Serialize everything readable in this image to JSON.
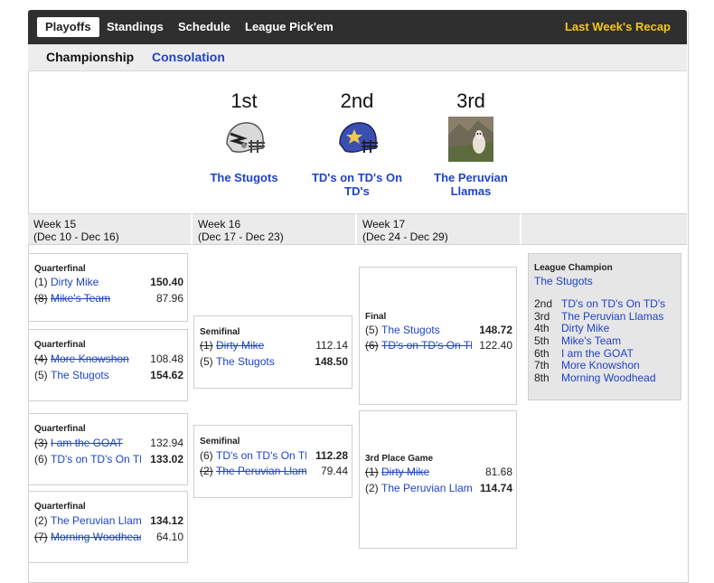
{
  "topnav": {
    "tabs": [
      {
        "label": "Playoffs",
        "active": true
      },
      {
        "label": "Standings",
        "active": false
      },
      {
        "label": "Schedule",
        "active": false
      },
      {
        "label": "League Pick'em",
        "active": false
      }
    ],
    "recap": "Last Week's Recap"
  },
  "subnav": {
    "championship": "Championship",
    "consolation": "Consolation"
  },
  "winners": [
    {
      "rank": "1st",
      "team": "The Stugots",
      "logo": "silver-helmet-icon"
    },
    {
      "rank": "2nd",
      "team": "TD's on TD's On TD's",
      "logo": "blue-helmet-icon"
    },
    {
      "rank": "3rd",
      "team": "The Peruvian Llamas",
      "logo": "llama-photo-icon"
    }
  ],
  "weeks": [
    {
      "label": "Week 15",
      "dates": "(Dec 10 - Dec 16)"
    },
    {
      "label": "Week 16",
      "dates": "(Dec 17 - Dec 23)"
    },
    {
      "label": "Week 17",
      "dates": "(Dec 24 - Dec 29)"
    }
  ],
  "matchups": {
    "qf1": {
      "round": "Quarterfinal",
      "teams": [
        {
          "seed": "(1)",
          "name": "Dirty Mike",
          "score": "150.40",
          "won": true
        },
        {
          "seed": "(8)",
          "name": "Mike's Team",
          "score": "87.96",
          "won": false
        }
      ]
    },
    "qf2": {
      "round": "Quarterfinal",
      "teams": [
        {
          "seed": "(4)",
          "name": "More Knowshon",
          "score": "108.48",
          "won": false
        },
        {
          "seed": "(5)",
          "name": "The Stugots",
          "score": "154.62",
          "won": true
        }
      ]
    },
    "qf3": {
      "round": "Quarterfinal",
      "teams": [
        {
          "seed": "(3)",
          "name": "I am the GOAT",
          "score": "132.94",
          "won": false
        },
        {
          "seed": "(6)",
          "name": "TD's on TD's On TD's",
          "score": "133.02",
          "won": true
        }
      ]
    },
    "qf4": {
      "round": "Quarterfinal",
      "teams": [
        {
          "seed": "(2)",
          "name": "The Peruvian Llamas",
          "score": "134.12",
          "won": true
        },
        {
          "seed": "(7)",
          "name": "Morning Woodhead",
          "score": "64.10",
          "won": false
        }
      ]
    },
    "sf1": {
      "round": "Semifinal",
      "teams": [
        {
          "seed": "(1)",
          "name": "Dirty Mike",
          "score": "112.14",
          "won": false
        },
        {
          "seed": "(5)",
          "name": "The Stugots",
          "score": "148.50",
          "won": true
        }
      ]
    },
    "sf2": {
      "round": "Semifinal",
      "teams": [
        {
          "seed": "(6)",
          "name": "TD's on TD's On TD's",
          "score": "112.28",
          "won": true
        },
        {
          "seed": "(2)",
          "name": "The Peruvian Llamas",
          "score": "79.44",
          "won": false
        }
      ]
    },
    "final": {
      "round": "Final",
      "teams": [
        {
          "seed": "(5)",
          "name": "The Stugots",
          "score": "148.72",
          "won": true
        },
        {
          "seed": "(6)",
          "name": "TD's on TD's On TD's",
          "score": "122.40",
          "won": false
        }
      ]
    },
    "third": {
      "round": "3rd Place Game",
      "teams": [
        {
          "seed": "(1)",
          "name": "Dirty Mike",
          "score": "81.68",
          "won": false
        },
        {
          "seed": "(2)",
          "name": "The Peruvian Llamas",
          "score": "114.74",
          "won": true
        }
      ]
    }
  },
  "champion": {
    "title": "League Champion",
    "name": "The Stugots",
    "finish": [
      {
        "place": "2nd",
        "team": "TD's on TD's On TD's"
      },
      {
        "place": "3rd",
        "team": "The Peruvian Llamas"
      },
      {
        "place": "4th",
        "team": "Dirty Mike"
      },
      {
        "place": "5th",
        "team": "Mike's Team"
      },
      {
        "place": "6th",
        "team": "I am the GOAT"
      },
      {
        "place": "7th",
        "team": "More Knowshon"
      },
      {
        "place": "8th",
        "team": "Morning Woodhead"
      }
    ]
  },
  "colors": {
    "link": "#1f43c9",
    "recap": "#f5c518",
    "nav_bg": "#2f2f2f"
  }
}
